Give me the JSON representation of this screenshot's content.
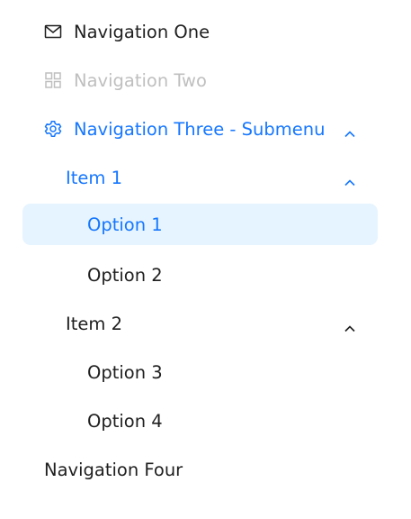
{
  "menu": {
    "nav_one": {
      "label": "Navigation One",
      "icon": "mail-icon"
    },
    "nav_two": {
      "label": "Navigation Two",
      "icon": "appstore-icon",
      "disabled": true
    },
    "nav_three": {
      "label": "Navigation Three - Submenu",
      "icon": "setting-icon",
      "expanded": true,
      "groups": [
        {
          "label": "Item 1",
          "expanded": true,
          "options": [
            {
              "label": "Option 1",
              "selected": true
            },
            {
              "label": "Option 2",
              "selected": false
            }
          ]
        },
        {
          "label": "Item 2",
          "expanded": true,
          "options": [
            {
              "label": "Option 3",
              "selected": false
            },
            {
              "label": "Option 4",
              "selected": false
            }
          ]
        }
      ]
    },
    "nav_four": {
      "label": "Navigation Four"
    }
  },
  "colors": {
    "accent": "#1677ff",
    "selected_bg": "#e6f4ff",
    "text": "#1f1f1f",
    "disabled_text": "#bfbfbf"
  }
}
